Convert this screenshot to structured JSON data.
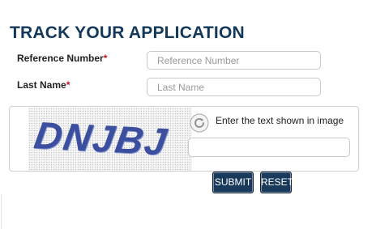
{
  "page": {
    "title": "TRACK YOUR APPLICATION"
  },
  "form": {
    "reference": {
      "label": "Reference Number",
      "required_mark": "*",
      "placeholder": "Reference Number",
      "value": ""
    },
    "last_name": {
      "label": "Last Name",
      "required_mark": "*",
      "placeholder": "Last Name",
      "value": ""
    },
    "captcha": {
      "image_text": "DNJBJ",
      "hint": "Enter the text shown in image",
      "refresh_icon": "refresh-icon",
      "value": ""
    },
    "buttons": {
      "submit": "SUBMIT",
      "reset": "RESET"
    }
  },
  "colors": {
    "title": "#13385a",
    "required": "#c0121f",
    "button_bg": "#1a3a5c",
    "captcha_text": "#3b4f9e"
  }
}
